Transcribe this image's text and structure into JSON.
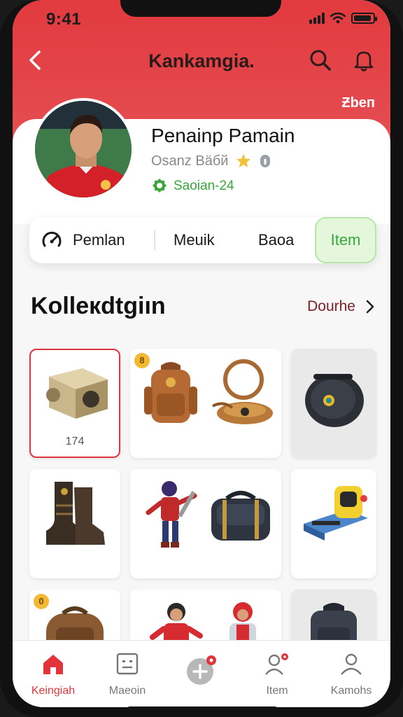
{
  "status": {
    "time": "9:41"
  },
  "header": {
    "title": "Kankamgia.",
    "edit_label": "Ƶbeп"
  },
  "player": {
    "name": "Penainp Pamain",
    "subtitle": "Osanz Bäбй",
    "season": "Saoian-24"
  },
  "tabs": [
    {
      "label": "Pemlan",
      "icon": "speed-icon"
    },
    {
      "label": "Meuik"
    },
    {
      "label": "Baoa"
    },
    {
      "label": "Item",
      "active": true
    }
  ],
  "collection": {
    "title": "Kolleкdtgiın",
    "see_all": "Dourhe",
    "first_item_count": "174",
    "badge_1": "8",
    "badge_2": "0"
  },
  "nav": [
    {
      "label": "Keingiah",
      "icon": "home-icon",
      "active": true
    },
    {
      "label": "Maeoin",
      "icon": "profile-card-icon"
    },
    {
      "label": "",
      "icon": "add-icon",
      "badge": true
    },
    {
      "label": "Item",
      "icon": "item-icon",
      "badge": true
    },
    {
      "label": "Kamohs",
      "icon": "user-icon"
    }
  ],
  "colors": {
    "accent": "#e2353b",
    "green": "#3aa53a",
    "link": "#7a1f25"
  }
}
